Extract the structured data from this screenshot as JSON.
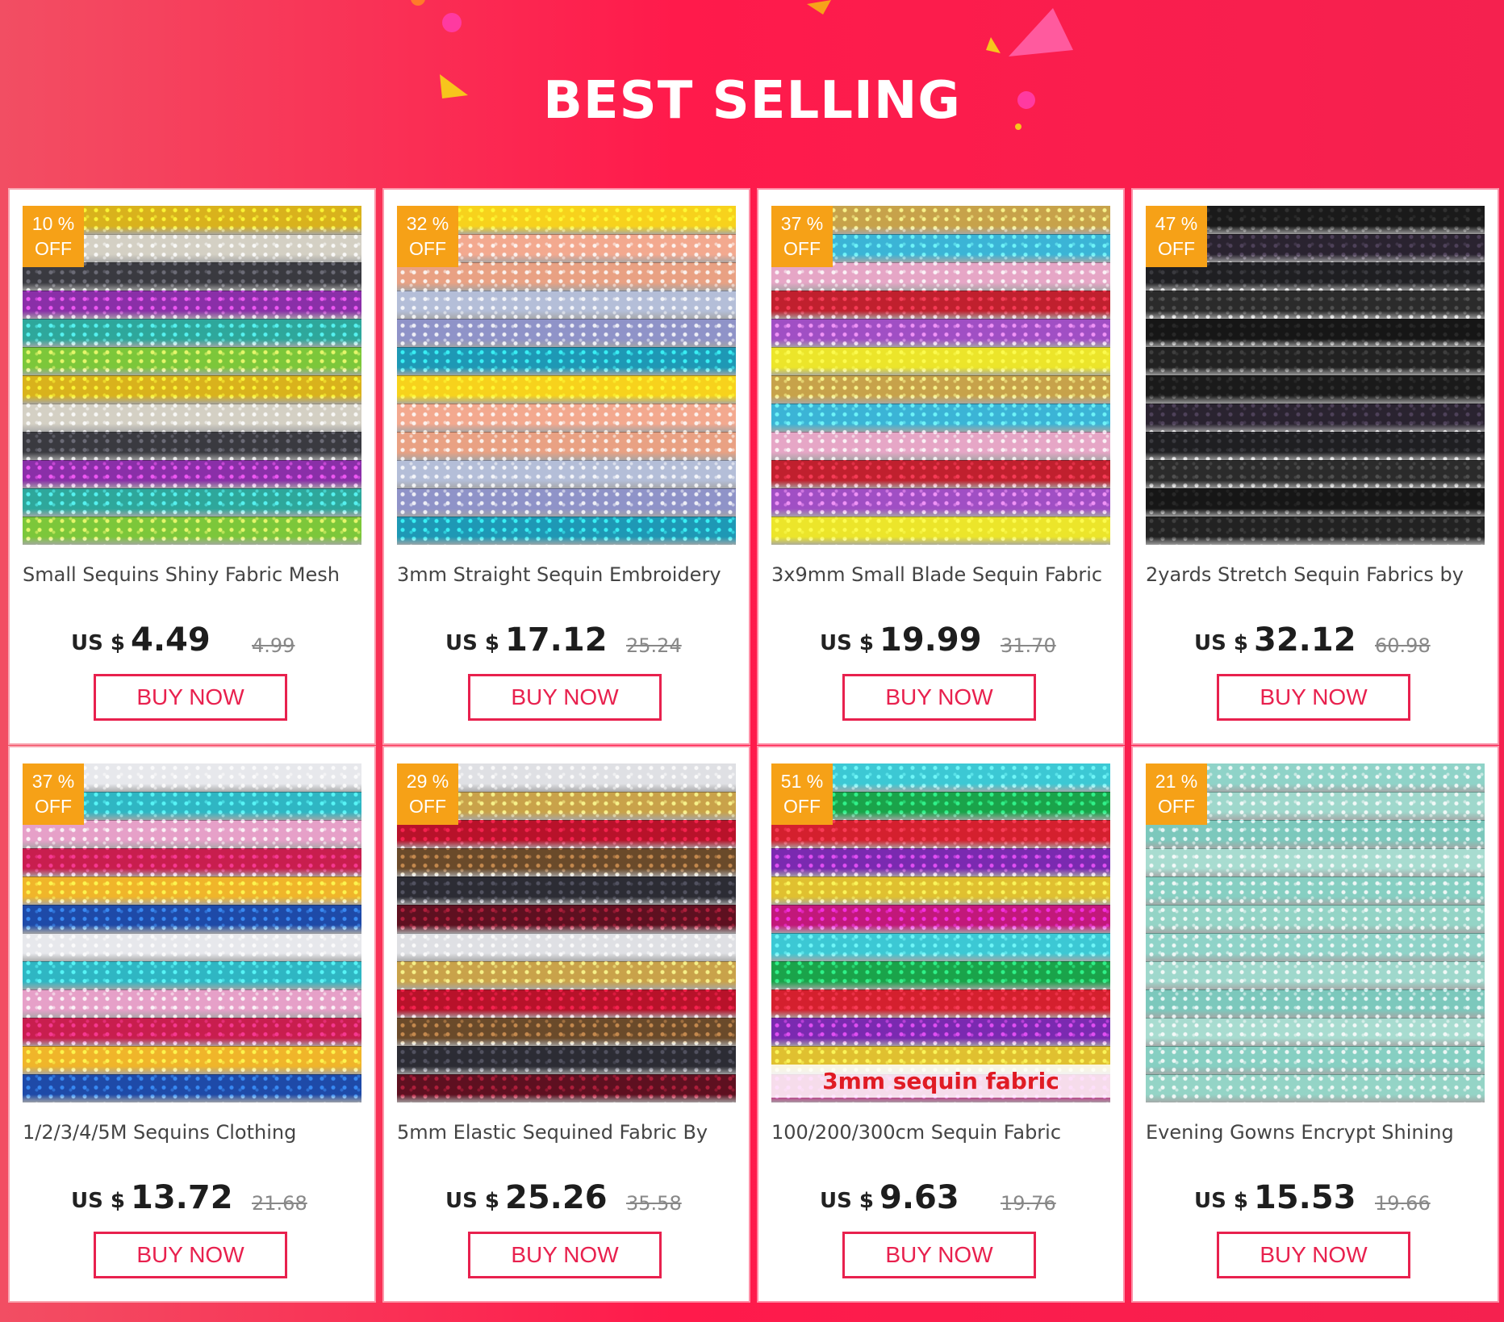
{
  "header": {
    "title": "BEST SELLING"
  },
  "colors": {
    "accent": "#e8214e",
    "badge": "#f6a117",
    "banner": "#ff1a4b"
  },
  "products": [
    {
      "discount": "10 %",
      "off": "OFF",
      "title": "Small Sequins Shiny Fabric Mesh",
      "currency": "US $",
      "price": "4.49",
      "old_price": "4.99",
      "button": "BUY NOW",
      "image_caption": "",
      "palette": [
        "#d9b21c",
        "#d4d0c4",
        "#3a3a40",
        "#8a2fa8",
        "#2ea79b",
        "#7cc73a"
      ]
    },
    {
      "discount": "32 %",
      "off": "OFF",
      "title": "3mm Straight Sequin Embroidery",
      "currency": "US $",
      "price": "17.12",
      "old_price": "25.24",
      "button": "BUY NOW",
      "image_caption": "",
      "palette": [
        "#f7d21c",
        "#f3a98f",
        "#e9a183",
        "#b4bed8",
        "#8f93c8",
        "#1e98b5"
      ]
    },
    {
      "discount": "37 %",
      "off": "OFF",
      "title": "3x9mm Small Blade Sequin Fabric",
      "currency": "US $",
      "price": "19.99",
      "old_price": "31.70",
      "button": "BUY NOW",
      "image_caption": "",
      "palette": [
        "#c7a24a",
        "#3bb4d6",
        "#e6a6c6",
        "#c0202e",
        "#a04fc4",
        "#ece52a"
      ]
    },
    {
      "discount": "47 %",
      "off": "OFF",
      "title": "2yards Stretch Sequin Fabrics by",
      "currency": "US $",
      "price": "32.12",
      "old_price": "60.98",
      "button": "BUY NOW",
      "image_caption": "",
      "palette": [
        "#1a1a1a",
        "#2a2330",
        "#1f1f22",
        "#2b2b2b",
        "#161616",
        "#222222"
      ]
    },
    {
      "discount": "37 %",
      "off": "OFF",
      "title": "1/2/3/4/5M Sequins Clothing",
      "currency": "US $",
      "price": "13.72",
      "old_price": "21.68",
      "button": "BUY NOW",
      "image_caption": "",
      "palette": [
        "#e7e8ec",
        "#2fb6c3",
        "#e6a0c8",
        "#c81e4e",
        "#f0b52a",
        "#1e4aa8"
      ]
    },
    {
      "discount": "29 %",
      "off": "OFF",
      "title": "5mm Elastic Sequined Fabric By",
      "currency": "US $",
      "price": "25.26",
      "old_price": "35.58",
      "button": "BUY NOW",
      "image_caption": "",
      "palette": [
        "#dfe0e4",
        "#c9a24a",
        "#b8122a",
        "#6a4a2a",
        "#2c2c34",
        "#5e1020"
      ]
    },
    {
      "discount": "51 %",
      "off": "OFF",
      "title": "100/200/300cm  Sequin Fabric",
      "currency": "US $",
      "price": "9.63",
      "old_price": "19.76",
      "button": "BUY NOW",
      "image_caption": "3mm sequin fabric",
      "palette": [
        "#3cc8d4",
        "#1aa34a",
        "#d4202e",
        "#7a2ab0",
        "#e0c030",
        "#c2187a"
      ]
    },
    {
      "discount": "21 %",
      "off": "OFF",
      "title": "Evening Gowns Encrypt Shining",
      "currency": "US $",
      "price": "15.53",
      "old_price": "19.66",
      "button": "BUY NOW",
      "image_caption": "",
      "palette": [
        "#8fd3c8",
        "#9fd8cc",
        "#7cc8bc",
        "#a8dcd0",
        "#86cfc2",
        "#94d4c6"
      ]
    }
  ]
}
